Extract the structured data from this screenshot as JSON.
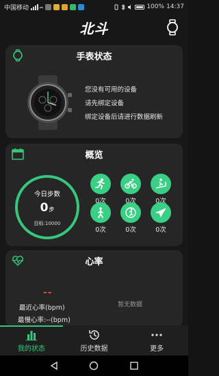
{
  "status_bar": {
    "carrier": "中国移动",
    "battery": "100%",
    "time": "14:37"
  },
  "header": {
    "logo_text": "北斗"
  },
  "watch_card": {
    "title": "手表状态",
    "lines": [
      "您没有可用的设备",
      "请先绑定设备",
      "绑定设备后请进行数据刷新"
    ]
  },
  "overview_card": {
    "title": "概览",
    "steps_label": "今日步数",
    "steps_value": "0",
    "steps_unit": "步",
    "steps_goal": "目标:10000",
    "sports": [
      {
        "icon": "running-icon",
        "count": "0次"
      },
      {
        "icon": "cycling-icon",
        "count": "0次"
      },
      {
        "icon": "treadmill-icon",
        "count": "0次"
      },
      {
        "icon": "walking-icon",
        "count": "0次"
      },
      {
        "icon": "climbing-icon",
        "count": "0次"
      },
      {
        "icon": "airplane-icon",
        "count": "0次"
      }
    ]
  },
  "heart_card": {
    "title": "心率",
    "latest": "最近心率(bpm)",
    "slowest": "最慢心率:--(bpm)",
    "no_data": "暂无数据",
    "dash": "--"
  },
  "tabs": [
    {
      "label": "我的状态",
      "icon": "bar-chart-icon",
      "active": true
    },
    {
      "label": "历史数据",
      "icon": "history-icon",
      "active": false
    },
    {
      "label": "更多",
      "icon": "more-dots-icon",
      "active": false
    }
  ],
  "colors": {
    "accent": "#36c67c",
    "card": "#262626",
    "background": "#171717",
    "heart_dash": "#e04848"
  }
}
